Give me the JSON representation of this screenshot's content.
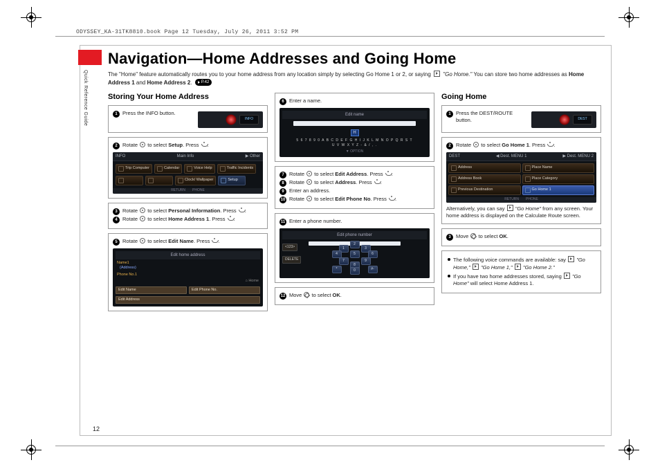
{
  "header_line": "ODYSSEY_KA-31TK8810.book  Page 12  Tuesday, July 26, 2011  3:52 PM",
  "side_label": "Quick Reference Guide",
  "page_number": "12",
  "title": "Navigation—Home Addresses and Going Home",
  "intro_a": "The \"Home\" feature automatically routes you to your home address from any location simply by selecting Go Home 1 or 2, or saying ",
  "intro_quote": "\"Go Home.\"",
  "intro_b": " You can store two home addresses as ",
  "intro_ha1": "Home Address 1",
  "intro_and": " and ",
  "intro_ha2": "Home Address 2",
  "intro_dot": ". ",
  "intro_pageref": "P.42",
  "col1": {
    "title": "Storing Your Home Address",
    "s1": "Press the INFO button.",
    "info_label": "INFO",
    "s2a": "Rotate ",
    "s2b": " to select ",
    "s2_bold": "Setup",
    "s2c": ". Press ",
    "info_bar_l": "INFO",
    "info_bar_c": "Main Info",
    "info_bar_r": "▶ Other",
    "tile1": "Trip Computer",
    "tile2": "Calendar",
    "tile3": "Voice Help",
    "tile4": "Traffic Incidents",
    "tile5": "",
    "tile6": "",
    "tile7": "Clock/ Wallpaper",
    "tile8": "Setup",
    "foot_l": "RETURN",
    "foot_r": "PHONE",
    "s3a": "Rotate ",
    "s3b": " to select ",
    "s3_bold": "Personal Information",
    "s3c": ". Press ",
    "s4a": "Rotate ",
    "s4b": " to select ",
    "s4_bold": "Home Address 1",
    "s4c": ". Press ",
    "s5a": "Rotate ",
    "s5b": " to select ",
    "s5_bold": "Edit Name",
    "s5c": ". Press ",
    "edit_hdr": "Edit home address",
    "lbl_name": "Name1",
    "val_name": "(Address)",
    "lbl_phone": "Phone No.1",
    "home_tag": "⌂ Home",
    "cell1": "Edit Name",
    "cell2": "Edit Phone No.",
    "cell3": "Edit Address"
  },
  "col2": {
    "s6": "Enter a name.",
    "kbd_hdr": "Edit name",
    "hbox": "H",
    "row1": "5 6 7 8 9 0 A B C D E F G H I J K L M N O P Q R S T",
    "row2": "U V W X Y Z - & /   ,  .",
    "opt": "▼ OPTION",
    "s7a": "Rotate ",
    "s7b": " to select ",
    "s7_bold": "Edit Address",
    "s7c": ". Press ",
    "s8a": "Rotate ",
    "s8b": " to select ",
    "s8_bold": "Address",
    "s8c": ". Press ",
    "s9": "Enter an address.",
    "s10a": "Rotate ",
    "s10b": " to select ",
    "s10_bold": "Edit Phone No",
    "s10c": ". Press ",
    "s11": "Enter a phone number.",
    "dial_hdr": "Edit phone number",
    "side1": "<123>",
    "side2": "DELETE",
    "k1": "1",
    "k2": "2",
    "k3": "3",
    "k4": "4",
    "k5": "5",
    "k6": "6",
    "k7": "7",
    "k8": "8",
    "k9": "9",
    "k0": "0",
    "kstar": "*",
    "khash": "#-",
    "s12a": "Move ",
    "s12b": " to select ",
    "s12_bold": "OK",
    "s12c": "."
  },
  "col3": {
    "title": "Going Home",
    "s1": "Press the DEST/ROUTE button.",
    "dest_label": "DEST",
    "s2a": "Rotate ",
    "s2b": " to select ",
    "s2_bold": "Go Home 1",
    "s2c": ". Press ",
    "bar_l": "DEST",
    "bar_c": "◀ Dest. MENU 1",
    "bar_r": "▶ Dest. MENU 2",
    "t1": "Address",
    "t2": "Place Name",
    "t3": "Address Book",
    "t4": "Place Category",
    "t5": "Previous Destination",
    "t6": "Go Home 1",
    "alt_a": "Alternatively, you can say ",
    "alt_quote": "\"Go Home\"",
    "alt_b": " from any screen. Your home address is displayed on the Calculate Route screen.",
    "s3a": "Move ",
    "s3b": " to select ",
    "s3_bold": "OK",
    "s3c": ".",
    "b1a": "The following voice commands are available: say ",
    "b1q1": "\"Go Home,\"",
    "b1q2": "\"Go Home 1,\"",
    "b1q3": "\"Go Home 2.\"",
    "b2a": "If you have two home addresses stored, saying ",
    "b2q": "\"Go Home\"",
    "b2b": " will select ",
    "b2bold": "Home Address 1",
    "b2c": "."
  }
}
